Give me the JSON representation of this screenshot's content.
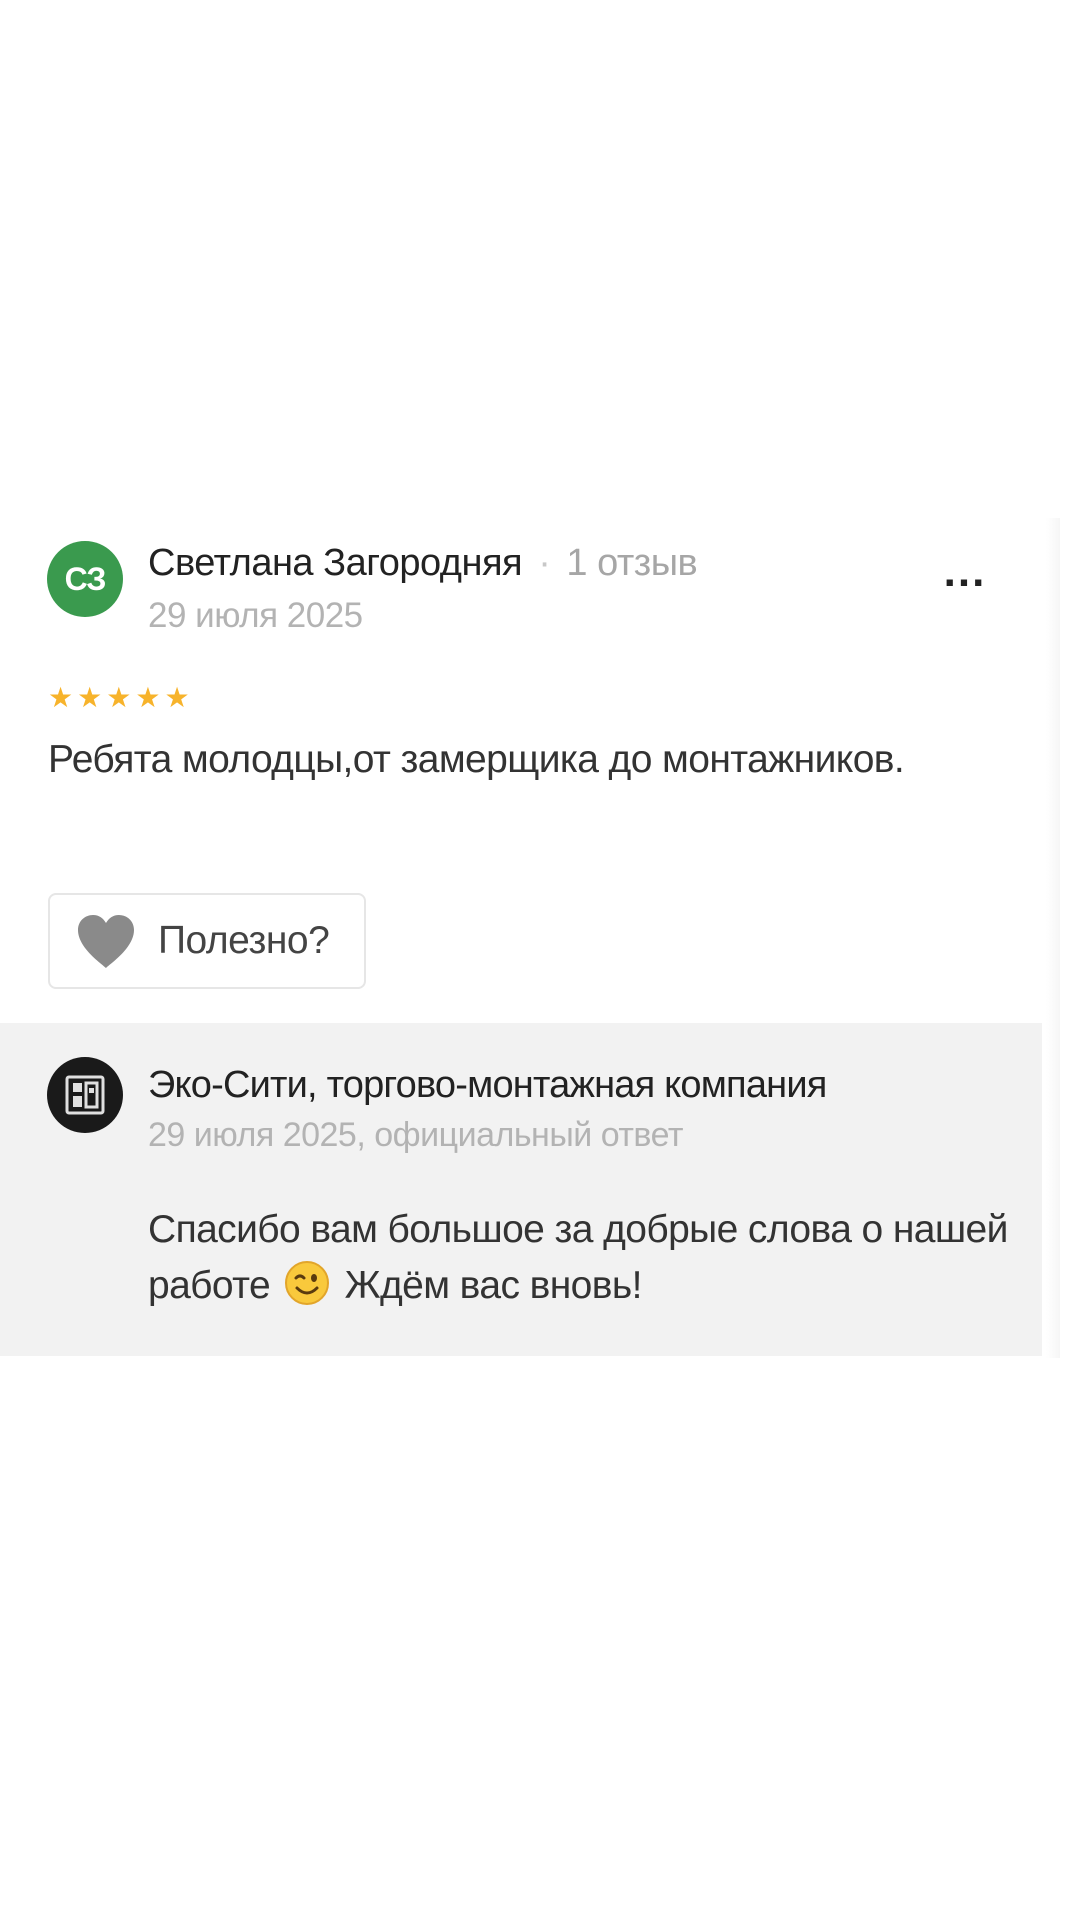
{
  "review": {
    "avatar_initials": "СЗ",
    "author_name": "Светлана Загородняя",
    "separator": "·",
    "author_review_count": "1 отзыв",
    "date": "29 июля 2025",
    "more_label": "...",
    "rating": 5,
    "stars": [
      "★",
      "★",
      "★",
      "★",
      "★"
    ],
    "text": "Ребята молодцы,от замерщика до монтажников.",
    "helpful_label": "Полезно?"
  },
  "reply": {
    "company_name": "Эко-Сити, торгово-монтажная компания",
    "meta": "29 июля 2025, официальный ответ",
    "text_before_emoji": "Спасибо вам большое за добрые слова о нашей работе",
    "emoji": "wink-emoji",
    "text_after_emoji": "Ждём вас вновь!"
  },
  "colors": {
    "avatar_user_bg": "#3a9a4e",
    "star": "#f7b32b",
    "reply_bg": "#f2f2f2",
    "muted_text": "#b3b3b3",
    "heart": "#8a8a8a"
  }
}
